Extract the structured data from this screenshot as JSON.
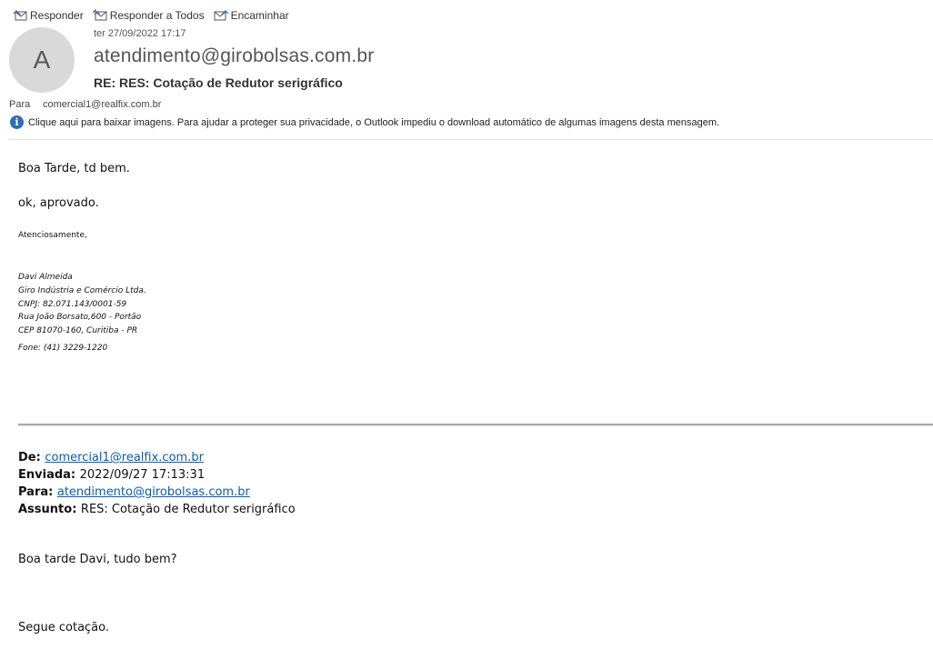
{
  "toolbar": {
    "reply": "Responder",
    "reply_all": "Responder a Todos",
    "forward": "Encaminhar"
  },
  "header": {
    "avatar_initial": "A",
    "date": "ter 27/09/2022 17:17",
    "sender": "atendimento@girobolsas.com.br",
    "subject": "RE: RES: Cotação de Redutor serigráfico",
    "to_label": "Para",
    "to_value": "comercial1@realfix.com.br",
    "info_text": "Clique aqui para baixar imagens. Para ajudar a proteger sua privacidade, o Outlook impediu o download automático de algumas imagens desta mensagem."
  },
  "body": {
    "greeting": "Boa Tarde, td bem.",
    "message": "ok, aprovado.",
    "closing": "Atenciosamente,",
    "signature": {
      "name": "Davi Almeida",
      "company": "Giro Indústria e Comércio Ltda.",
      "cnpj": "CNPJ: 82.071.143/0001-59",
      "address": "Rua João Borsato,600 - Portão",
      "cep": "CEP 81070-160, Curitiba - PR",
      "phone": "Fone:  (41) 3229-1220"
    }
  },
  "quoted": {
    "from_label": "De:",
    "from_value": "comercial1@realfix.com.br",
    "sent_label": "Enviada:",
    "sent_value": "2022/09/27 17:13:31",
    "to_label": "Para:",
    "to_value": "atendimento@girobolsas.com.br",
    "subject_label": "Assunto:",
    "subject_value": "RES: Cotação de Redutor serigráfico",
    "greeting": "Boa tarde Davi, tudo bem?",
    "line2": "Segue cotação."
  },
  "colors": {
    "link": "#0b5cad",
    "info_icon": "#2f6db5",
    "avatar_bg": "#d9d9d9"
  },
  "icons": {
    "reply": "reply-envelope-icon",
    "reply_all": "reply-all-envelope-icon",
    "forward": "forward-envelope-icon",
    "info": "info-icon"
  }
}
